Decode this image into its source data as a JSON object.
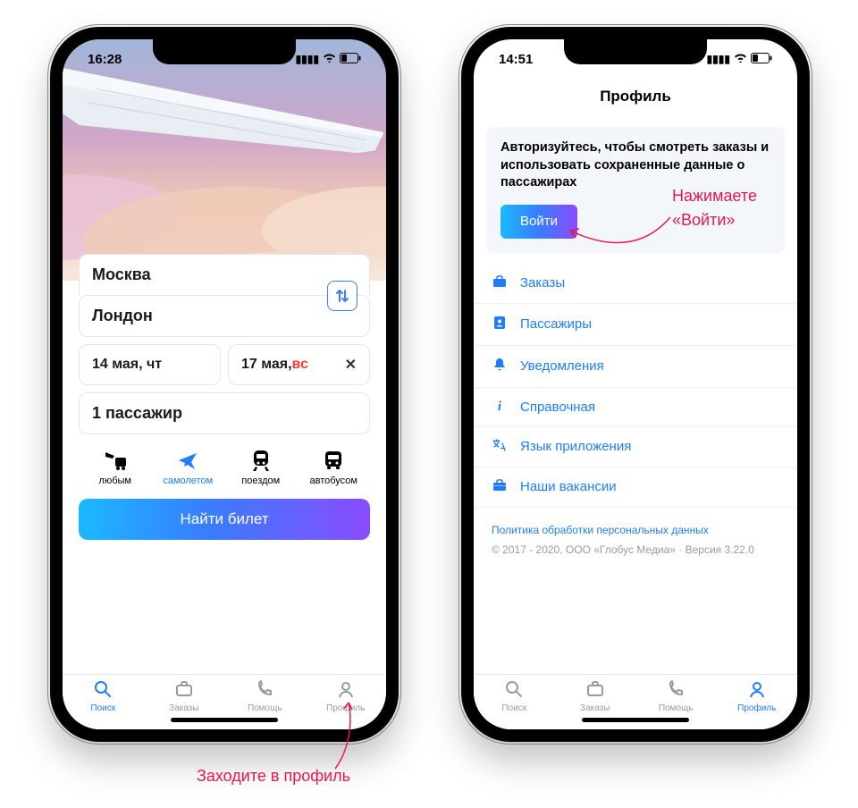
{
  "left": {
    "status_time": "16:28",
    "from_city": "Москва",
    "to_city": "Лондон",
    "date_out": "14 мая, чт",
    "date_back_prefix": "17 мая, ",
    "date_back_day": "вс",
    "passengers": "1 пассажир",
    "modes": {
      "any": "любым",
      "plane": "самолетом",
      "train": "поездом",
      "bus": "автобусом"
    },
    "find_button": "Найти билет",
    "tabs": {
      "search": "Поиск",
      "orders": "Заказы",
      "help": "Помощь",
      "profile": "Профиль"
    }
  },
  "right": {
    "status_time": "14:51",
    "title": "Профиль",
    "auth_text": "Авторизуйтесь, чтобы смотреть заказы и использовать сохраненные данные о пассажирах",
    "login_button": "Войти",
    "menu": {
      "orders": "Заказы",
      "passengers": "Пассажиры",
      "notifications": "Уведомления",
      "help": "Справочная",
      "language": "Язык приложения",
      "jobs": "Наши вакансии"
    },
    "privacy_link": "Политика обработки персональных данных",
    "copyright": "© 2017 - 2020, ООО «Глобус Медиа» · Версия 3.22.0",
    "tabs": {
      "search": "Поиск",
      "orders": "Заказы",
      "help": "Помощь",
      "profile": "Профиль"
    }
  },
  "annotations": {
    "go_profile": "Заходите в профиль",
    "press_login_1": "Нажимаете",
    "press_login_2": "«Войти»"
  }
}
